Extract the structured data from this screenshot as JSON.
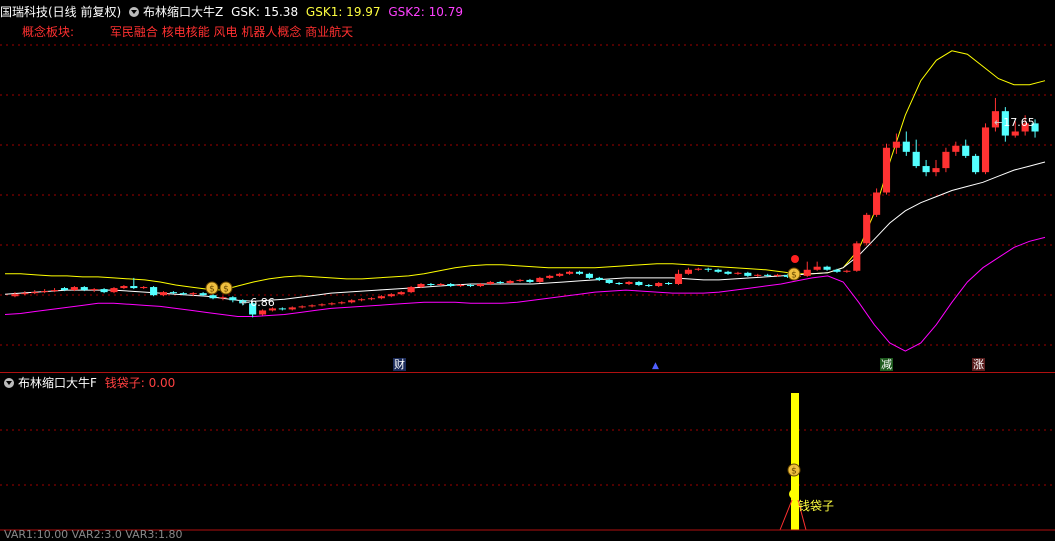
{
  "header": {
    "stock": "国瑞科技(日线 前复权)",
    "indicator": "布林缩口大牛Z",
    "gsk": "GSK: 15.38",
    "gsk1": "GSK1: 19.97",
    "gsk2": "GSK2: 10.79",
    "concept_label": "概念板块:",
    "concepts": "军民融合 核电核能 风电 机器人概念 商业航天"
  },
  "price_labels": {
    "high": "17.65",
    "low": "6.86"
  },
  "markers": {
    "cai": "财",
    "jian": "减",
    "zhang": "涨"
  },
  "sub": {
    "indicator": "布林缩口大牛F",
    "value_label": "钱袋子: 0.00",
    "signal_label": "钱袋子"
  },
  "bottom_status": "VAR1:10.00 VAR2:3.0 VAR3:1.80",
  "colors": {
    "up": "#ff3232",
    "down": "#54ffff",
    "upper_band": "#ffff00",
    "mid_band": "#ffffff",
    "lower_band": "#ff00ff",
    "grid": "#a00000"
  },
  "chart_data": {
    "type": "candlestick",
    "price_range": [
      5.5,
      20.5
    ],
    "candles": [
      [
        7.9,
        8.0,
        7.85,
        8.1
      ],
      [
        8.0,
        8.05,
        7.95,
        8.15
      ],
      [
        8.05,
        8.1,
        8.0,
        8.2
      ],
      [
        8.1,
        8.15,
        8.05,
        8.25
      ],
      [
        8.15,
        8.2,
        8.1,
        8.3
      ],
      [
        8.3,
        8.2,
        8.15,
        8.35
      ],
      [
        8.2,
        8.35,
        8.15,
        8.4
      ],
      [
        8.35,
        8.2,
        8.15,
        8.4
      ],
      [
        8.2,
        8.25,
        8.1,
        8.3
      ],
      [
        8.25,
        8.1,
        8.05,
        8.3
      ],
      [
        8.1,
        8.3,
        8.05,
        8.35
      ],
      [
        8.3,
        8.4,
        8.25,
        8.45
      ],
      [
        8.4,
        8.3,
        8.25,
        8.8
      ],
      [
        8.3,
        8.35,
        8.25,
        8.4
      ],
      [
        8.35,
        7.95,
        7.9,
        8.4
      ],
      [
        7.95,
        8.1,
        7.9,
        8.15
      ],
      [
        8.1,
        8.05,
        8.0,
        8.15
      ],
      [
        8.05,
        8.0,
        7.95,
        8.1
      ],
      [
        8.0,
        8.05,
        7.9,
        8.1
      ],
      [
        8.05,
        7.95,
        7.9,
        8.1
      ],
      [
        7.95,
        7.8,
        7.75,
        8.0
      ],
      [
        7.8,
        7.85,
        7.7,
        7.9
      ],
      [
        7.85,
        7.7,
        7.6,
        7.9
      ],
      [
        7.7,
        7.55,
        7.45,
        7.75
      ],
      [
        7.55,
        7.0,
        6.86,
        7.6
      ],
      [
        7.0,
        7.2,
        6.95,
        7.25
      ],
      [
        7.2,
        7.3,
        7.15,
        7.35
      ],
      [
        7.3,
        7.25,
        7.2,
        7.35
      ],
      [
        7.25,
        7.35,
        7.2,
        7.4
      ],
      [
        7.35,
        7.4,
        7.3,
        7.45
      ],
      [
        7.4,
        7.45,
        7.35,
        7.5
      ],
      [
        7.45,
        7.5,
        7.4,
        7.55
      ],
      [
        7.5,
        7.55,
        7.45,
        7.6
      ],
      [
        7.55,
        7.6,
        7.5,
        7.65
      ],
      [
        7.6,
        7.7,
        7.55,
        7.75
      ],
      [
        7.7,
        7.75,
        7.65,
        7.8
      ],
      [
        7.75,
        7.8,
        7.7,
        7.85
      ],
      [
        7.8,
        7.9,
        7.75,
        7.95
      ],
      [
        7.9,
        8.0,
        7.85,
        8.05
      ],
      [
        8.0,
        8.1,
        7.95,
        8.15
      ],
      [
        8.1,
        8.35,
        8.05,
        8.4
      ],
      [
        8.35,
        8.5,
        8.3,
        8.55
      ],
      [
        8.5,
        8.45,
        8.4,
        8.55
      ],
      [
        8.45,
        8.5,
        8.4,
        8.55
      ],
      [
        8.5,
        8.4,
        8.35,
        8.55
      ],
      [
        8.4,
        8.45,
        8.35,
        8.5
      ],
      [
        8.45,
        8.4,
        8.35,
        8.5
      ],
      [
        8.4,
        8.5,
        8.35,
        8.55
      ],
      [
        8.5,
        8.6,
        8.45,
        8.65
      ],
      [
        8.6,
        8.55,
        8.5,
        8.65
      ],
      [
        8.55,
        8.65,
        8.5,
        8.7
      ],
      [
        8.65,
        8.7,
        8.6,
        8.75
      ],
      [
        8.7,
        8.6,
        8.55,
        8.75
      ],
      [
        8.6,
        8.8,
        8.55,
        8.85
      ],
      [
        8.8,
        8.9,
        8.75,
        8.95
      ],
      [
        8.9,
        9.0,
        8.85,
        9.05
      ],
      [
        9.0,
        9.1,
        8.95,
        9.15
      ],
      [
        9.1,
        9.0,
        8.95,
        9.15
      ],
      [
        9.0,
        8.8,
        8.75,
        9.05
      ],
      [
        8.8,
        8.7,
        8.65,
        8.85
      ],
      [
        8.7,
        8.55,
        8.5,
        8.75
      ],
      [
        8.55,
        8.5,
        8.45,
        8.6
      ],
      [
        8.5,
        8.6,
        8.45,
        8.65
      ],
      [
        8.6,
        8.45,
        8.4,
        8.65
      ],
      [
        8.45,
        8.4,
        8.35,
        8.5
      ],
      [
        8.4,
        8.55,
        8.35,
        8.6
      ],
      [
        8.55,
        8.5,
        8.45,
        8.6
      ],
      [
        8.5,
        9.0,
        8.45,
        9.2
      ],
      [
        9.0,
        9.2,
        8.95,
        9.3
      ],
      [
        9.2,
        9.25,
        9.15,
        9.3
      ],
      [
        9.25,
        9.2,
        9.1,
        9.3
      ],
      [
        9.2,
        9.1,
        9.05,
        9.25
      ],
      [
        9.1,
        9.0,
        8.95,
        9.15
      ],
      [
        9.0,
        9.05,
        8.95,
        9.1
      ],
      [
        9.05,
        8.9,
        8.85,
        9.1
      ],
      [
        8.9,
        8.95,
        8.85,
        9.0
      ],
      [
        8.95,
        8.9,
        8.85,
        9.0
      ],
      [
        8.9,
        8.95,
        8.85,
        9.0
      ],
      [
        8.95,
        8.85,
        8.8,
        9.0
      ],
      [
        8.85,
        8.9,
        8.8,
        8.95
      ],
      [
        8.9,
        9.2,
        8.85,
        9.6
      ],
      [
        9.2,
        9.35,
        9.15,
        9.6
      ],
      [
        9.35,
        9.2,
        9.15,
        9.4
      ],
      [
        9.2,
        9.1,
        9.05,
        9.25
      ],
      [
        9.1,
        9.15,
        9.05,
        9.2
      ],
      [
        9.15,
        10.5,
        9.1,
        10.6
      ],
      [
        10.5,
        11.9,
        10.4,
        12.0
      ],
      [
        11.9,
        13.0,
        11.8,
        13.2
      ],
      [
        13.0,
        15.2,
        12.9,
        15.4
      ],
      [
        15.2,
        15.5,
        14.9,
        15.9
      ],
      [
        15.5,
        15.0,
        14.8,
        16.0
      ],
      [
        15.0,
        14.3,
        14.2,
        15.6
      ],
      [
        14.3,
        14.0,
        13.8,
        14.6
      ],
      [
        14.0,
        14.2,
        13.8,
        14.6
      ],
      [
        14.2,
        15.0,
        14.0,
        15.2
      ],
      [
        15.0,
        15.3,
        14.8,
        15.5
      ],
      [
        15.3,
        14.8,
        14.7,
        15.6
      ],
      [
        14.8,
        14.0,
        13.9,
        14.9
      ],
      [
        14.0,
        16.2,
        13.9,
        16.4
      ],
      [
        16.2,
        17.0,
        16.0,
        17.65
      ],
      [
        17.0,
        15.8,
        15.5,
        17.2
      ],
      [
        15.8,
        16.0,
        15.7,
        16.5
      ],
      [
        16.0,
        16.4,
        15.8,
        16.8
      ],
      [
        16.4,
        16.0,
        15.7,
        16.6
      ]
    ],
    "upper_band": [
      9.0,
      9.0,
      8.95,
      8.9,
      8.9,
      8.85,
      8.85,
      8.8,
      8.75,
      8.7,
      8.6,
      8.45,
      8.35,
      8.25,
      8.2,
      8.4,
      8.6,
      8.75,
      8.85,
      8.9,
      8.85,
      8.8,
      8.75,
      8.75,
      8.8,
      8.85,
      8.9,
      9.0,
      9.15,
      9.3,
      9.4,
      9.45,
      9.45,
      9.4,
      9.35,
      9.3,
      9.3,
      9.3,
      9.3,
      9.35,
      9.4,
      9.45,
      9.5,
      9.5,
      9.45,
      9.4,
      9.35,
      9.3,
      9.25,
      9.2,
      9.1,
      9.0,
      9.0,
      9.05,
      9.3,
      10.2,
      12.0,
      14.5,
      16.8,
      18.5,
      19.5,
      19.97,
      19.8,
      19.2,
      18.6,
      18.3,
      18.3,
      18.5
    ],
    "mid_band": [
      8.0,
      8.05,
      8.1,
      8.15,
      8.2,
      8.2,
      8.2,
      8.2,
      8.15,
      8.1,
      8.05,
      8.0,
      7.95,
      7.9,
      7.8,
      7.7,
      7.65,
      7.7,
      7.75,
      7.85,
      7.95,
      8.05,
      8.1,
      8.15,
      8.2,
      8.25,
      8.3,
      8.35,
      8.4,
      8.45,
      8.5,
      8.5,
      8.5,
      8.5,
      8.5,
      8.55,
      8.6,
      8.65,
      8.7,
      8.75,
      8.8,
      8.8,
      8.8,
      8.8,
      8.75,
      8.7,
      8.7,
      8.75,
      8.8,
      8.85,
      8.9,
      8.95,
      9.0,
      9.05,
      9.3,
      9.9,
      10.7,
      11.5,
      12.1,
      12.5,
      12.8,
      13.1,
      13.3,
      13.5,
      13.8,
      14.1,
      14.3,
      14.5
    ],
    "lower_band": [
      7.0,
      7.05,
      7.15,
      7.25,
      7.35,
      7.45,
      7.55,
      7.55,
      7.5,
      7.45,
      7.4,
      7.3,
      7.2,
      7.1,
      7.0,
      6.9,
      6.9,
      6.95,
      7.0,
      7.1,
      7.2,
      7.3,
      7.35,
      7.4,
      7.45,
      7.5,
      7.55,
      7.6,
      7.6,
      7.6,
      7.55,
      7.55,
      7.55,
      7.6,
      7.7,
      7.8,
      7.9,
      8.0,
      8.1,
      8.15,
      8.2,
      8.15,
      8.1,
      8.05,
      8.05,
      8.05,
      8.1,
      8.2,
      8.3,
      8.4,
      8.5,
      8.65,
      8.8,
      8.9,
      8.6,
      7.6,
      6.5,
      5.6,
      5.2,
      5.6,
      6.5,
      7.6,
      8.6,
      9.3,
      9.8,
      10.3,
      10.6,
      10.79
    ]
  }
}
